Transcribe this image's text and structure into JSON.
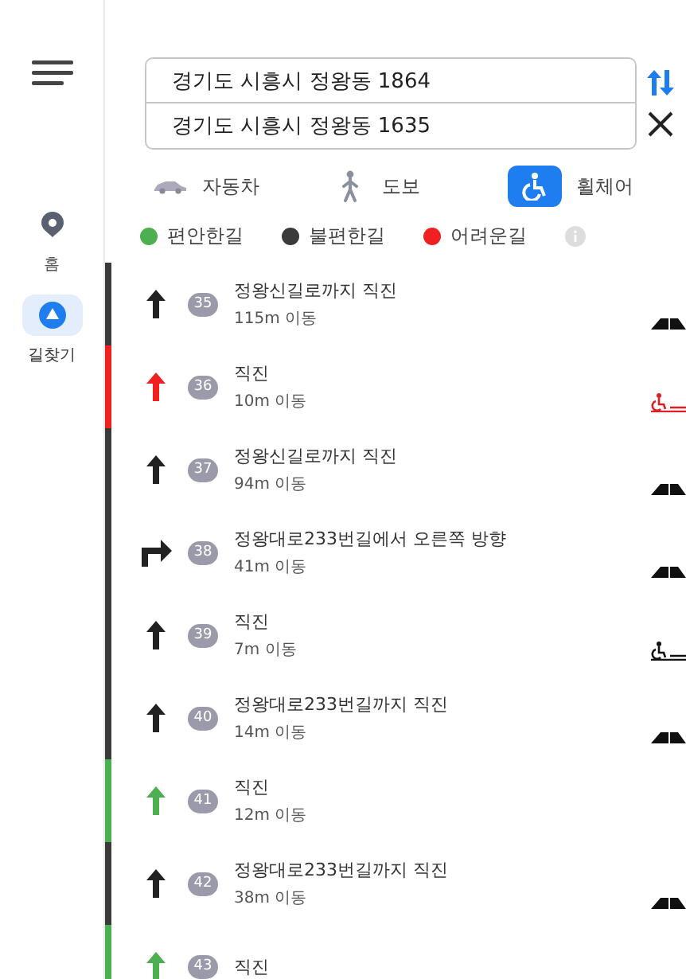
{
  "sidebar": {
    "items": [
      {
        "label": "홈",
        "kind": "home",
        "selected": false
      },
      {
        "label": "길찾기",
        "kind": "directions",
        "selected": true
      }
    ]
  },
  "route": {
    "origin": "경기도 시흥시 정왕동 1864",
    "destination": "경기도 시흥시 정왕동 1635"
  },
  "modes": [
    {
      "label": "자동차",
      "kind": "car",
      "selected": false
    },
    {
      "label": "도보",
      "kind": "walk",
      "selected": false
    },
    {
      "label": "휠체어",
      "kind": "wheelchair",
      "selected": true
    }
  ],
  "legend": [
    {
      "label": "편안한길",
      "color": "#4caf50"
    },
    {
      "label": "불편한길",
      "color": "#3a3a3a"
    },
    {
      "label": "어려운길",
      "color": "#f02020"
    }
  ],
  "steps": [
    {
      "number": "35",
      "instruction": "정왕신길로까지 직진",
      "distance": "115m 이동",
      "arrow": {
        "kind": "straight"
      },
      "color": "#3a3a3a",
      "feature": {
        "kind": "road"
      }
    },
    {
      "number": "36",
      "instruction": "직진",
      "distance": "10m 이동",
      "arrow": {
        "kind": "straight"
      },
      "color": "#f02020",
      "feature": {
        "kind": "ramp"
      }
    },
    {
      "number": "37",
      "instruction": "정왕신길로까지 직진",
      "distance": "94m 이동",
      "arrow": {
        "kind": "straight"
      },
      "color": "#3a3a3a",
      "feature": {
        "kind": "road"
      }
    },
    {
      "number": "38",
      "instruction": "정왕대로233번길에서 오른쪽 방향",
      "distance": "41m 이동",
      "arrow": {
        "kind": "right"
      },
      "color": "#3a3a3a",
      "feature": {
        "kind": "road"
      }
    },
    {
      "number": "39",
      "instruction": "직진",
      "distance": "7m 이동",
      "arrow": {
        "kind": "straight"
      },
      "color": "#3a3a3a",
      "feature": {
        "kind": "ramp"
      }
    },
    {
      "number": "40",
      "instruction": "정왕대로233번길까지 직진",
      "distance": "14m 이동",
      "arrow": {
        "kind": "straight"
      },
      "color": "#3a3a3a",
      "feature": {
        "kind": "road"
      }
    },
    {
      "number": "41",
      "instruction": "직진",
      "distance": "12m 이동",
      "arrow": {
        "kind": "straight"
      },
      "color": "#4caf50"
    },
    {
      "number": "42",
      "instruction": "정왕대로233번길까지 직진",
      "distance": "38m 이동",
      "arrow": {
        "kind": "straight"
      },
      "color": "#3a3a3a",
      "feature": {
        "kind": "road"
      }
    },
    {
      "number": "43",
      "instruction": "직진",
      "arrow": {
        "kind": "straight"
      },
      "color": "#4caf50"
    }
  ]
}
